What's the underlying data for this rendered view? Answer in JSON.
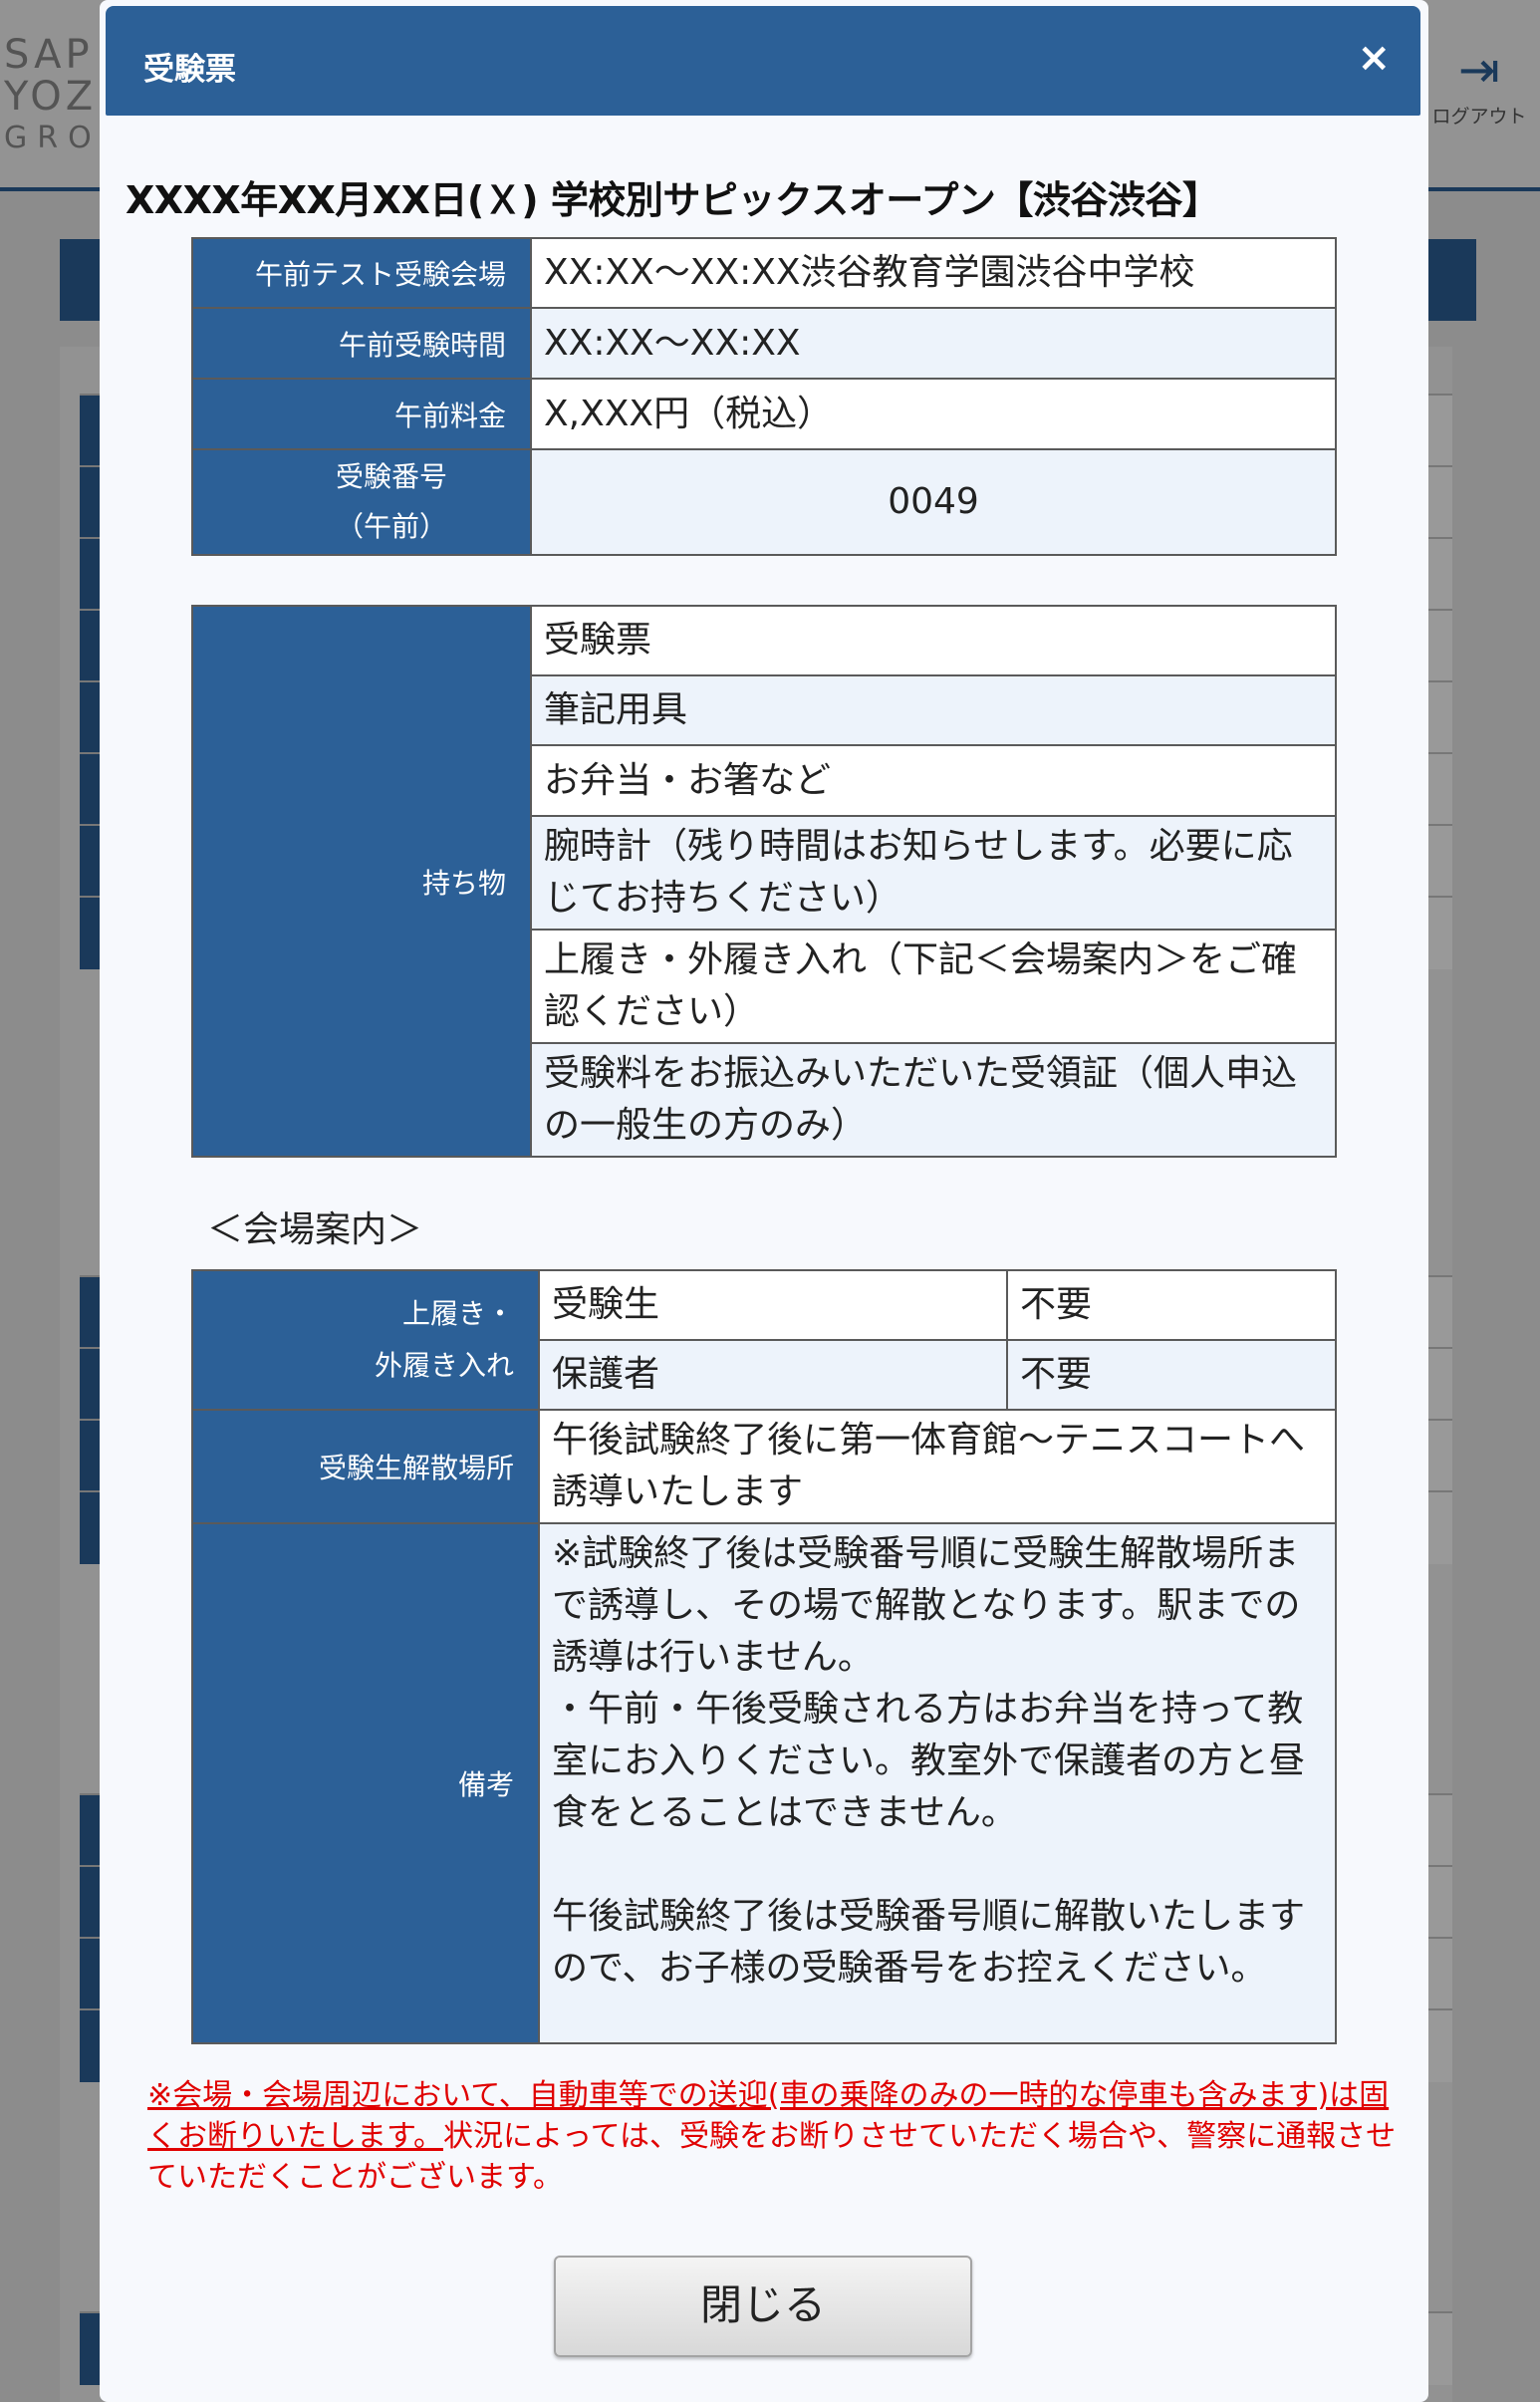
{
  "background": {
    "logo_lines": [
      "SAP",
      "YOZE",
      "GROU"
    ],
    "logout_label": "ログアウト",
    "logout_icon": "logout-icon"
  },
  "modal": {
    "title": "受験票",
    "close_symbol": "×",
    "exam_title": "XXXX年XX月XX日(Ｘ) 学校別サピックスオープン【渋谷渋谷】",
    "am_table": [
      {
        "label": "午前テスト受験会場",
        "value": "XX:XX～XX:XX渋谷教育学園渋谷中学校"
      },
      {
        "label": "午前受験時間",
        "value": "XX:XX～XX:XX"
      },
      {
        "label": "午前料金",
        "value": "X,XXX円（税込）"
      },
      {
        "label_line1": "受験番号",
        "label_line2": "（午前）",
        "value": "0049"
      }
    ],
    "belongings": {
      "label": "持ち物",
      "items": [
        "受験票",
        "筆記用具",
        "お弁当・お箸など",
        "腕時計（残り時間はお知らせします。必要に応じてお持ちください）",
        "上履き・外履き入れ（下記＜会場案内＞をご確認ください）",
        "受験料をお振込みいただいた受領証（個人申込の一般生の方のみ）"
      ]
    },
    "venue_heading": "＜会場案内＞",
    "venue": {
      "shoes_label_line1": "上履き・",
      "shoes_label_line2": "外履き入れ",
      "shoes_rows": [
        {
          "who": "受験生",
          "need": "不要"
        },
        {
          "who": "保護者",
          "need": "不要"
        }
      ],
      "dismissal_label": "受験生解散場所",
      "dismissal_value": "午後試験終了後に第一体育館～テニスコートへ誘導いたします",
      "notes_label": "備考",
      "notes_p1": "※試験終了後は受験番号順に受験生解散場所まで誘導し、その場で解散となります。駅までの誘導は行いません。",
      "notes_p2": "・午前・午後受験される方はお弁当を持って教室にお入りください。教室外で保護者の方と昼食をとることはできません。",
      "notes_p3": "午後試験終了後は受験番号順に解散いたしますので、お子様の受験番号をお控えください。"
    },
    "notice_underlined": "※会場・会場周辺において、自動車等での送迎(車の乗降のみの一時的な停車も含みます)は固くお断りいたします。",
    "notice_rest": "状況によっては、受験をお断りさせていただく場合や、警察に通報させていただくことがございます。",
    "close_button_label": "閉じる"
  }
}
